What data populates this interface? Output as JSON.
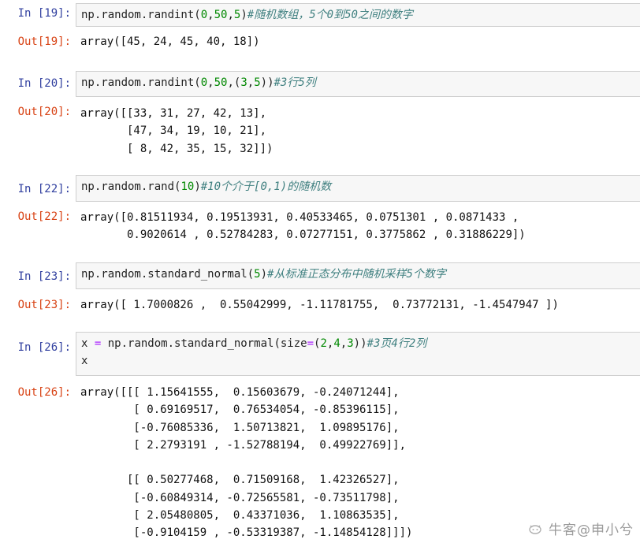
{
  "cells": [
    {
      "in_prompt": "In  [19]:",
      "out_prompt": "Out[19]:",
      "code_lines": [
        [
          {
            "t": "np.random.randint",
            "c": "name"
          },
          {
            "t": "(",
            "c": "name"
          },
          {
            "t": "0",
            "c": "num"
          },
          {
            "t": ",",
            "c": "name"
          },
          {
            "t": "50",
            "c": "num"
          },
          {
            "t": ",",
            "c": "name"
          },
          {
            "t": "5",
            "c": "num"
          },
          {
            "t": ")",
            "c": "name"
          },
          {
            "t": "#随机数组，5个0到50之间的数字",
            "c": "comment"
          }
        ]
      ],
      "output": "array([45, 24, 45, 40, 18])"
    },
    {
      "in_prompt": "In  [20]:",
      "out_prompt": "Out[20]:",
      "code_lines": [
        [
          {
            "t": "np.random.randint",
            "c": "name"
          },
          {
            "t": "(",
            "c": "name"
          },
          {
            "t": "0",
            "c": "num"
          },
          {
            "t": ",",
            "c": "name"
          },
          {
            "t": "50",
            "c": "num"
          },
          {
            "t": ",(",
            "c": "name"
          },
          {
            "t": "3",
            "c": "num"
          },
          {
            "t": ",",
            "c": "name"
          },
          {
            "t": "5",
            "c": "num"
          },
          {
            "t": "))",
            "c": "name"
          },
          {
            "t": "#3行5列",
            "c": "comment"
          }
        ]
      ],
      "output": "array([[33, 31, 27, 42, 13],\n       [47, 34, 19, 10, 21],\n       [ 8, 42, 35, 15, 32]])"
    },
    {
      "in_prompt": "In  [22]:",
      "out_prompt": "Out[22]:",
      "code_lines": [
        [
          {
            "t": "np.random.rand",
            "c": "name"
          },
          {
            "t": "(",
            "c": "name"
          },
          {
            "t": "10",
            "c": "num"
          },
          {
            "t": ")",
            "c": "name"
          },
          {
            "t": "#10个介于[0,1)的随机数",
            "c": "comment"
          }
        ]
      ],
      "output": "array([0.81511934, 0.19513931, 0.40533465, 0.0751301 , 0.0871433 ,\n       0.9020614 , 0.52784283, 0.07277151, 0.3775862 , 0.31886229])"
    },
    {
      "in_prompt": "In  [23]:",
      "out_prompt": "Out[23]:",
      "code_lines": [
        [
          {
            "t": "np.random.standard_normal",
            "c": "name"
          },
          {
            "t": "(",
            "c": "name"
          },
          {
            "t": "5",
            "c": "num"
          },
          {
            "t": ")",
            "c": "name"
          },
          {
            "t": "#从标准正态分布中随机采样5个数字",
            "c": "comment"
          }
        ]
      ],
      "output": "array([ 1.7000826 ,  0.55042999, -1.11781755,  0.73772131, -1.4547947 ])"
    },
    {
      "in_prompt": "In  [26]:",
      "out_prompt": "Out[26]:",
      "code_lines": [
        [
          {
            "t": "x ",
            "c": "name"
          },
          {
            "t": "=",
            "c": "op"
          },
          {
            "t": " np.random.standard_normal",
            "c": "name"
          },
          {
            "t": "(size",
            "c": "name"
          },
          {
            "t": "=",
            "c": "op"
          },
          {
            "t": "(",
            "c": "name"
          },
          {
            "t": "2",
            "c": "num"
          },
          {
            "t": ",",
            "c": "name"
          },
          {
            "t": "4",
            "c": "num"
          },
          {
            "t": ",",
            "c": "name"
          },
          {
            "t": "3",
            "c": "num"
          },
          {
            "t": "))",
            "c": "name"
          },
          {
            "t": "#3页4行2列",
            "c": "comment"
          }
        ],
        [
          {
            "t": "x",
            "c": "name"
          }
        ]
      ],
      "output": "array([[[ 1.15641555,  0.15603679, -0.24071244],\n        [ 0.69169517,  0.76534054, -0.85396115],\n        [-0.76085336,  1.50713821,  1.09895176],\n        [ 2.2793191 , -1.52788194,  0.49922769]],\n\n       [[ 0.50277468,  0.71509168,  1.42326527],\n        [-0.60849314, -0.72565581, -0.73511798],\n        [ 2.05480805,  0.43371036,  1.10863535],\n        [-0.9104159 , -0.53319387, -1.14854128]]])"
    }
  ],
  "watermark": {
    "icon": "nowcoder-logo-icon",
    "text": "牛客@申小兮"
  }
}
